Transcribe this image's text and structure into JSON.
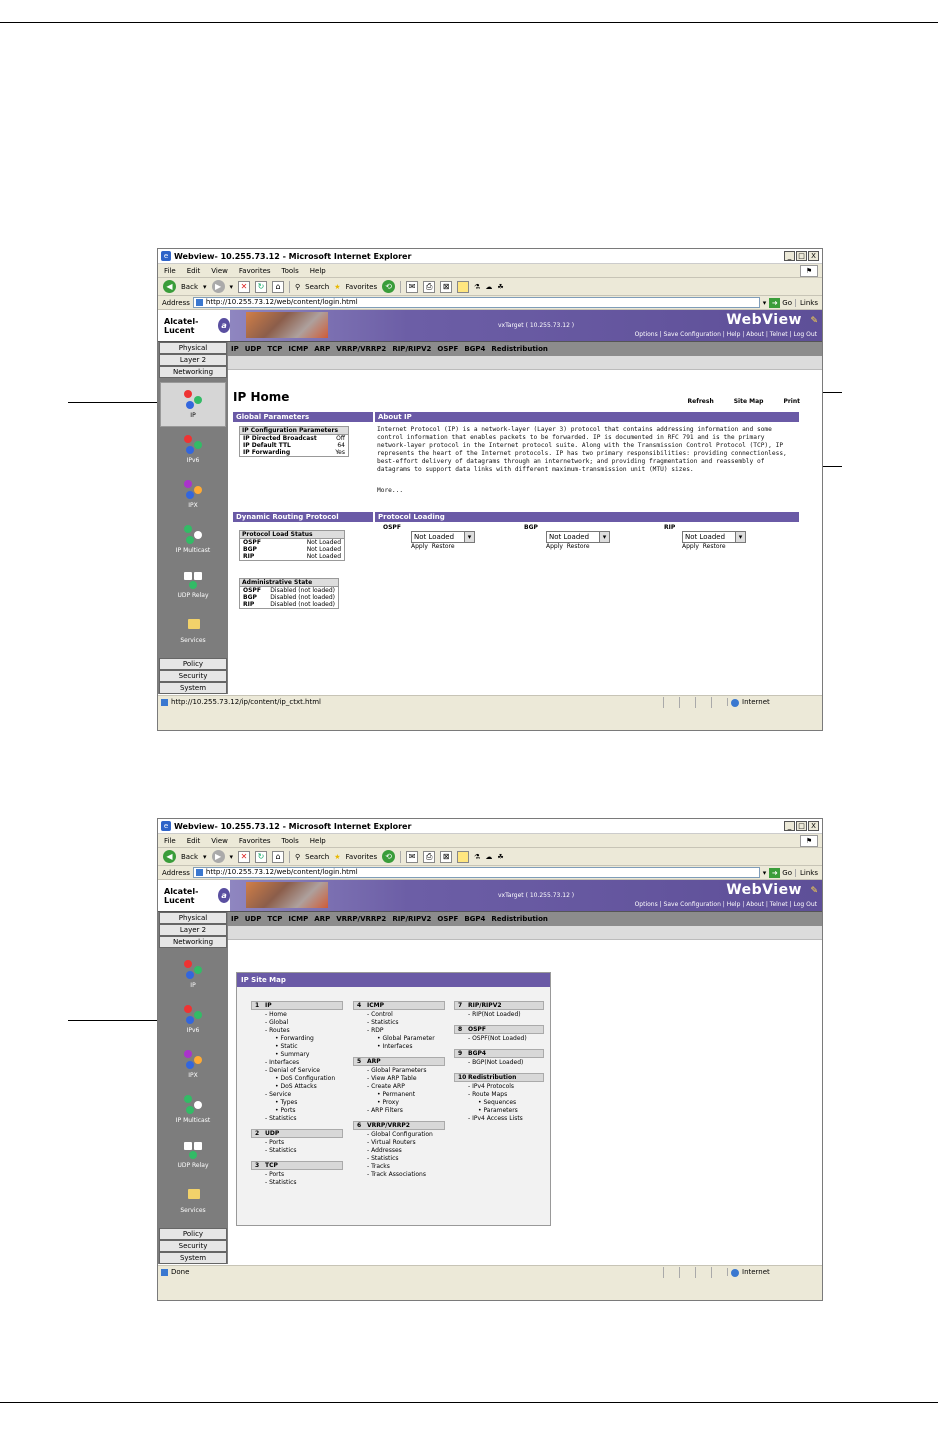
{
  "browser": {
    "title": "Webview- 10.255.73.12 - Microsoft Internet Explorer",
    "menu": [
      "File",
      "Edit",
      "View",
      "Favorites",
      "Tools",
      "Help"
    ],
    "toolbar": {
      "back": "Back",
      "search": "Search",
      "favorites": "Favorites"
    },
    "address_label": "Address",
    "go_label": "Go",
    "links_label": "Links",
    "zone": "Internet",
    "win_buttons": [
      "_",
      "□",
      "X"
    ]
  },
  "webview": {
    "logo": "Alcatel-Lucent",
    "target": "vxTarget  ( 10.255.73.12 )",
    "brand": "WebView",
    "links": "Options  |  Save Configuration  |  Help  |  About  |  Telnet  |  Log Out",
    "categories_top": [
      "Physical",
      "Layer 2",
      "Networking"
    ],
    "categories_bottom": [
      "Policy",
      "Security",
      "System"
    ],
    "nav": [
      "IP",
      "IPv6",
      "IPX",
      "IP Multicast",
      "UDP Relay",
      "Services"
    ],
    "subtabs": [
      "IP",
      "UDP",
      "TCP",
      "ICMP",
      "ARP",
      "VRRP/VRRP2",
      "RIP/RIPV2",
      "OSPF",
      "BGP4",
      "Redistribution"
    ]
  },
  "shot1": {
    "address": "http://10.255.73.12/web/content/login.html",
    "status": "http://10.255.73.12/ip/content/ip_ctxt.html",
    "page_title": "IP Home",
    "actions": [
      "Refresh",
      "Site Map",
      "Print"
    ],
    "global_params_head": "Global Parameters",
    "about_head": "About IP",
    "config_box": {
      "title": "IP Configuration Parameters",
      "rows": [
        {
          "k": "IP Directed Broadcast",
          "v": "Off"
        },
        {
          "k": "IP Default TTL",
          "v": "64"
        },
        {
          "k": "IP Forwarding",
          "v": "Yes"
        }
      ]
    },
    "about_lines": [
      "Internet Protocol (IP) is a network-layer (Layer 3) protocol that contains addressing information and some",
      "control information that enables packets to be forwarded. IP is documented in RFC 791 and is the primary",
      "network-layer protocol in the Internet protocol suite. Along with the Transmission Control Protocol (TCP), IP",
      "represents the heart of the Internet protocols. IP has two primary responsibilities: providing connectionless,",
      "best-effort delivery of datagrams through an internetwork; and providing fragmentation and reassembly of",
      "datagrams to support data links with different maximum-transmission unit (MTU) sizes."
    ],
    "more": "More...",
    "dyn_head": "Dynamic Routing Protocol",
    "loading_head": "Protocol Loading",
    "load_status": {
      "title": "Protocol Load Status",
      "rows": [
        {
          "k": "OSPF",
          "v": "Not Loaded"
        },
        {
          "k": "BGP",
          "v": "Not Loaded"
        },
        {
          "k": "RIP",
          "v": "Not Loaded"
        }
      ]
    },
    "admin_state": {
      "title": "Administrative State",
      "rows": [
        {
          "k": "OSPF",
          "v": "Disabled (not loaded)"
        },
        {
          "k": "BGP",
          "v": "Disabled (not loaded)"
        },
        {
          "k": "RIP",
          "v": "Disabled (not loaded)"
        }
      ]
    },
    "protocols": [
      {
        "name": "OSPF",
        "value": "Not Loaded"
      },
      {
        "name": "BGP",
        "value": "Not Loaded"
      },
      {
        "name": "RIP",
        "value": "Not Loaded"
      }
    ],
    "apply": "Apply",
    "restore": "Restore"
  },
  "shot2": {
    "address": "http://10.255.73.12/web/content/login.html",
    "status": "Done",
    "sitemap_title": "IP Site Map",
    "col1": [
      {
        "n": "1",
        "h": "IP",
        "items": [
          [
            "Home",
            1
          ],
          [
            "Global",
            1
          ],
          [
            "Routes",
            1
          ],
          [
            "Forwarding",
            2
          ],
          [
            "Static",
            2
          ],
          [
            "Summary",
            2
          ],
          [
            "Interfaces",
            1
          ],
          [
            "Denial of Service",
            1
          ],
          [
            "DoS Configuration",
            2
          ],
          [
            "DoS Attacks",
            2
          ],
          [
            "Service",
            1
          ],
          [
            "Types",
            2
          ],
          [
            "Ports",
            2
          ],
          [
            "Statistics",
            1
          ]
        ]
      },
      {
        "n": "2",
        "h": "UDP",
        "items": [
          [
            "Ports",
            1
          ],
          [
            "Statistics",
            1
          ]
        ]
      },
      {
        "n": "3",
        "h": "TCP",
        "items": [
          [
            "Ports",
            1
          ],
          [
            "Statistics",
            1
          ]
        ]
      }
    ],
    "col2": [
      {
        "n": "4",
        "h": "ICMP",
        "items": [
          [
            "Control",
            1
          ],
          [
            "Statistics",
            1
          ],
          [
            "RDP",
            1
          ],
          [
            "Global Parameter",
            2
          ],
          [
            "Interfaces",
            2
          ]
        ]
      },
      {
        "n": "5",
        "h": "ARP",
        "items": [
          [
            "Global Parameters",
            1
          ],
          [
            "View ARP Table",
            1
          ],
          [
            "Create ARP",
            1
          ],
          [
            "Permanent",
            2
          ],
          [
            "Proxy",
            2
          ],
          [
            "ARP Filters",
            1
          ]
        ]
      },
      {
        "n": "6",
        "h": "VRRP/VRRP2",
        "items": [
          [
            "Global Configuration",
            1
          ],
          [
            "Virtual Routers",
            1
          ],
          [
            "Addresses",
            1
          ],
          [
            "Statistics",
            1
          ],
          [
            "Tracks",
            1
          ],
          [
            "Track Associations",
            1
          ]
        ]
      }
    ],
    "col3": [
      {
        "n": "7",
        "h": "RIP/RIPV2",
        "items": [
          [
            "RIP(Not Loaded)",
            1
          ]
        ]
      },
      {
        "n": "8",
        "h": "OSPF",
        "items": [
          [
            "OSPF(Not Loaded)",
            1
          ]
        ]
      },
      {
        "n": "9",
        "h": "BGP4",
        "items": [
          [
            "BGP(Not Loaded)",
            1
          ]
        ]
      },
      {
        "n": "10",
        "h": "Redistribution",
        "items": [
          [
            "IPv4 Protocols",
            1
          ],
          [
            "Route Maps",
            1
          ],
          [
            "Sequences",
            2
          ],
          [
            "Parameters",
            2
          ],
          [
            "IPv4 Access Lists",
            1
          ]
        ]
      }
    ]
  }
}
